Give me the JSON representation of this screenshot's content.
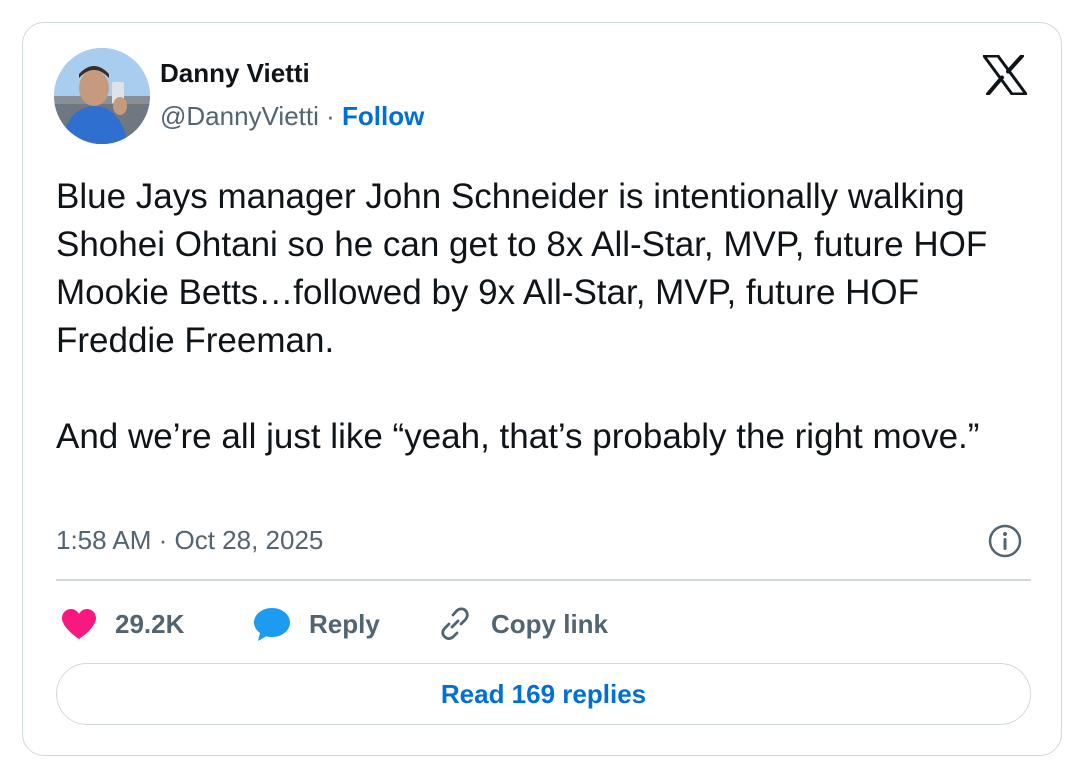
{
  "author": {
    "name": "Danny Vietti",
    "handle": "@DannyVietti",
    "separator": "·",
    "follow_label": "Follow"
  },
  "platform_icon": "x-logo-icon",
  "tweet": {
    "paragraphs": [
      "Blue Jays manager John Schneider is intentionally walking Shohei Ohtani so he can get to 8x All-Star, MVP, future HOF Mookie Betts…followed by 9x All-Star, MVP, future HOF Freddie Freeman.",
      "And we’re all just like “yeah, that’s probably the right move.”"
    ],
    "timestamp": "1:58 AM · Oct 28, 2025"
  },
  "actions": {
    "like_count": "29.2K",
    "reply_label": "Reply",
    "copy_link_label": "Copy link"
  },
  "read_replies_label": "Read 169 replies",
  "icons": {
    "like": "heart-icon",
    "reply": "speech-bubble-icon",
    "copy": "link-icon",
    "info": "info-icon"
  },
  "colors": {
    "link_blue": "#006fd6",
    "like_pink": "#f91880",
    "reply_blue": "#1d9bf0",
    "text": "#0f1419",
    "muted": "#536471",
    "border": "#cfd9de"
  }
}
